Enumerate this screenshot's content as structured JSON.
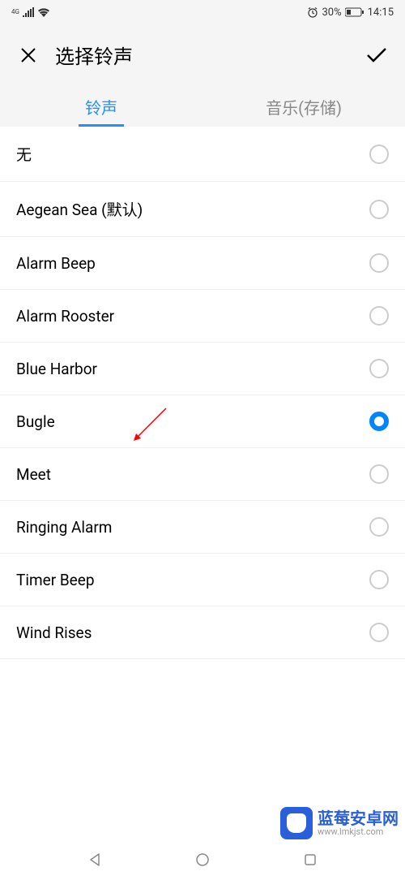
{
  "status": {
    "network_type": "4G",
    "battery_percent": "30%",
    "time": "14:15"
  },
  "header": {
    "title": "选择铃声"
  },
  "tabs": [
    {
      "label": "铃声",
      "active": true
    },
    {
      "label": "音乐(存储)",
      "active": false
    }
  ],
  "ringtones": [
    {
      "label": "无",
      "selected": false
    },
    {
      "label": "Aegean Sea (默认)",
      "selected": false
    },
    {
      "label": "Alarm Beep",
      "selected": false
    },
    {
      "label": "Alarm Rooster",
      "selected": false
    },
    {
      "label": "Blue Harbor",
      "selected": false
    },
    {
      "label": "Bugle",
      "selected": true
    },
    {
      "label": "Meet",
      "selected": false
    },
    {
      "label": "Ringing Alarm",
      "selected": false
    },
    {
      "label": "Timer Beep",
      "selected": false
    },
    {
      "label": "Wind Rises",
      "selected": false
    }
  ],
  "watermark": {
    "main": "蓝莓安卓网",
    "sub": "www.lmkjst.com"
  }
}
